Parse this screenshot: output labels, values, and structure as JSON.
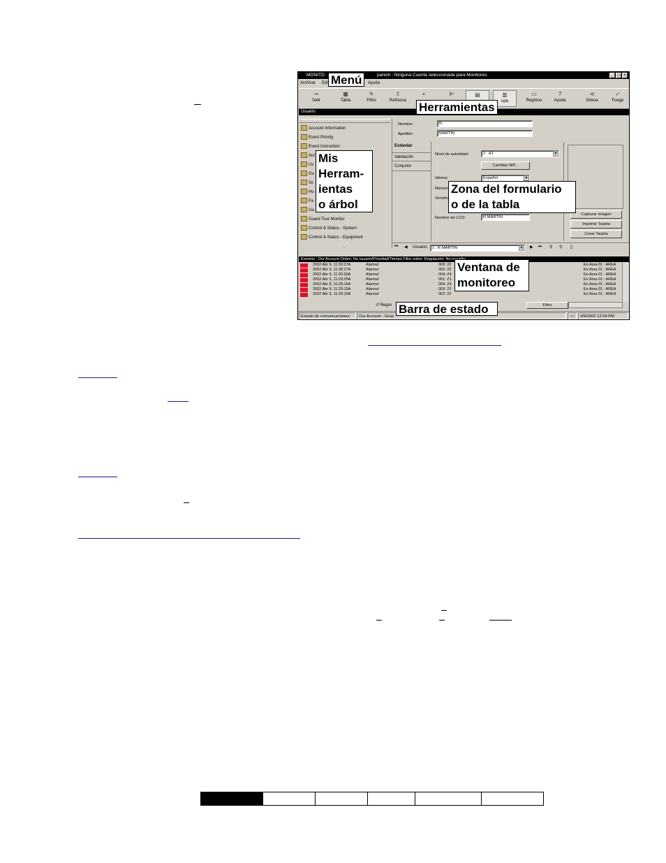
{
  "window": {
    "title_left": "MONITO",
    "title_right": "panish - Ninguna Cuenta seleccionada para Monitoreo.",
    "controls": [
      "_",
      "□",
      "×"
    ],
    "menu": [
      "Archivar",
      "Edic",
      "Ayuda"
    ],
    "toolbar": [
      {
        "label": "Salir",
        "icon": "key-icon",
        "glyph": "⊸"
      },
      {
        "label": "Tabla",
        "icon": "table-icon",
        "glyph": "▦"
      },
      {
        "label": "Filtro",
        "icon": "filter-icon",
        "glyph": "✎"
      },
      {
        "label": "Refresca",
        "icon": "refresh-icon",
        "glyph": "⇳"
      },
      {
        "label": "",
        "icon": "save-icon",
        "glyph": "▪"
      },
      {
        "label": "",
        "icon": "tree-icon",
        "glyph": "⊫"
      },
      {
        "label": "",
        "icon": "form-icon",
        "glyph": "▤"
      },
      {
        "label": "upa",
        "icon": "group-icon",
        "glyph": "▥"
      },
      {
        "label": "Regreso",
        "icon": "back-icon",
        "glyph": "▭"
      },
      {
        "label": "Ayuda",
        "icon": "help-icon",
        "glyph": "?"
      },
      {
        "label": "Sirena",
        "icon": "siren-icon",
        "glyph": "⊲"
      },
      {
        "label": "Fuego",
        "icon": "fire-icon",
        "glyph": "✓"
      }
    ],
    "panel_header": "Usuario",
    "tree": [
      "Account Information",
      "Event Priority",
      "Event Instruction",
      "Aut",
      "Us",
      "Gu",
      "Sc",
      "Ho",
      "Fa",
      "Gu",
      "Guard Tour Monitor",
      "Control & Status - System",
      "Control & Status - Equipment"
    ],
    "tree_collapse": "-",
    "form": {
      "nombre_label": "Nombre:",
      "nombre_value": "R",
      "apellido_label": "Apellido:",
      "apellido_value": "MARTIN",
      "tabs": [
        "Estándar",
        "Validación",
        "Conjunto"
      ],
      "nivel_label": "Nivel de autoridad:",
      "nivel_value": "1 : A1",
      "cambiar_nip": "Cambiar NIP...",
      "idioma_label": "Idioma:",
      "idioma_value": "Español",
      "numero_label": "Número",
      "version_label": "Versión",
      "lcd_label": "Nombre de LCD:",
      "lcd_value": "R MARTIN",
      "capturar": "Capturar imagen",
      "imprimir": "Imprimir Tarjeta",
      "crear": "Crear Tarjeta"
    },
    "nav": {
      "usuario_label": "Usuario:",
      "usuario_value": "1 : R MARTIN"
    },
    "events": {
      "header": "Eventos - Our Account   Orden: No usuario/Prioridad/Tiempo   Filtro sobre:   Regulación: No-resuelto",
      "rows": [
        {
          "date": "2002 Abr 9, 11:30:27A",
          "type": "Alarma!",
          "code": "003: 22",
          "area": "En Area 01 : AREA"
        },
        {
          "date": "2002 Abr 9, 11:30:27A",
          "type": "Alarma!",
          "code": "002: 22",
          "area": "En Area 01 : AREA"
        },
        {
          "date": "2002 Abr 9, 11:30:26A",
          "type": "Alarma!",
          "code": "004: Z4",
          "area": "En Area 01 : AREA"
        },
        {
          "date": "2002 Abr 9, 11:29:25A",
          "type": "Alarma!",
          "code": "001: Z1",
          "area": "En Area 01 : AREA"
        },
        {
          "date": "2002 Abr 9, 11:29:15A",
          "type": "Alarma!",
          "code": "004: Z4",
          "area": "En Area 01 : AREA"
        },
        {
          "date": "2002 Abr 9, 11:29:15A",
          "type": "Alarma!",
          "code": "003: 23",
          "area": "En Area 01 : AREA"
        },
        {
          "date": "2002 Abr 9, 11:29:15A",
          "type": "Alarma!",
          "code": "002: 22",
          "area": "En Area 01 : AREA"
        }
      ],
      "regre": "Regre",
      "filtro": "Filtro"
    },
    "status": {
      "comms": "Estado de comunicaciones:",
      "account": "Our Account - Grup",
      "datetime": "4/9/2002 12:59 PM"
    }
  },
  "callouts": {
    "menu": "Menú",
    "herramientas": "Herramientas",
    "arbol": "Mis\nHerram-\nientas\no árbol",
    "zona": "Zona del formulario\no de la tabla",
    "monitoreo": "Ventana de\nmonitoreo",
    "barra": "Barra de estado"
  },
  "colors": {
    "window_bg": "#d4d0c8",
    "alarm": "#e0102a",
    "title_bg": "#000000"
  }
}
